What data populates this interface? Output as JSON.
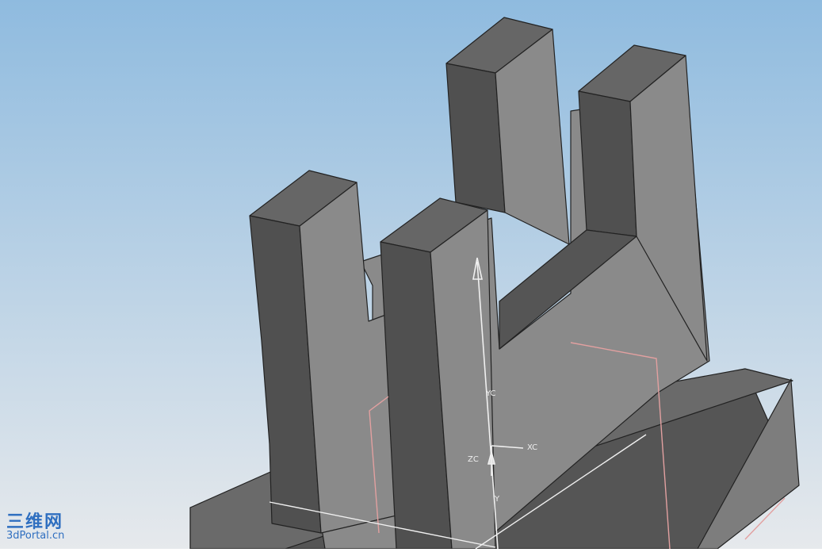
{
  "viewport": {
    "background_top": "#8fbbdf",
    "background_bottom": "#e6e9ec"
  },
  "triad": {
    "x_label": "XC",
    "y_label": "YC",
    "z_label": "ZC",
    "y_marker": "Y"
  },
  "watermark": {
    "chinese": "三维网",
    "site": "3dPortal.cn"
  },
  "colors": {
    "face_light": "#8a8a8a",
    "face_top": "#666666",
    "face_dark": "#505050",
    "edge": "#222222",
    "datum": "#e2a0a0",
    "axis": "#f0f0f0"
  }
}
